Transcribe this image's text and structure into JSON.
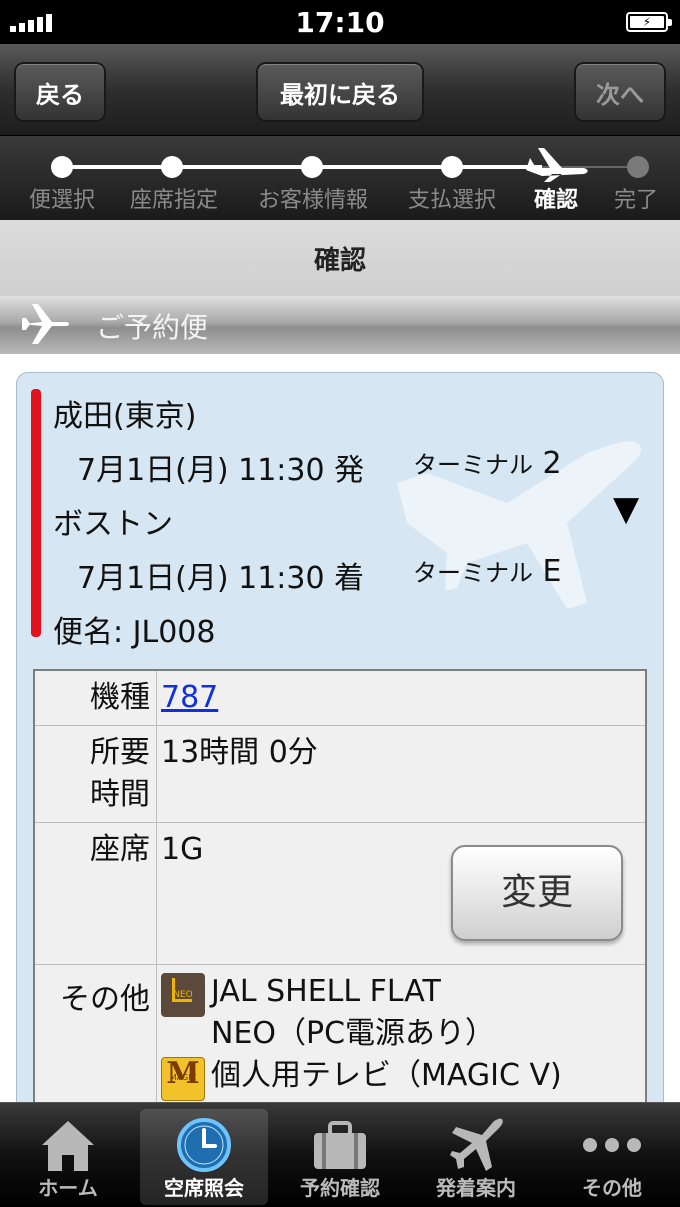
{
  "status": {
    "time": "17:10"
  },
  "nav": {
    "back": "戻る",
    "first": "最初に戻る",
    "next": "次へ"
  },
  "progress": {
    "steps": [
      "便選択",
      "座席指定",
      "お客様情報",
      "支払選択",
      "確認",
      "完了"
    ],
    "active_index": 4
  },
  "title": "確認",
  "section": {
    "label": "ご予約便"
  },
  "flight": {
    "origin": "成田(東京)",
    "depart": "7月1日(月) 11:30 発",
    "depart_terminal_label": "ターミナル",
    "depart_terminal": "2",
    "destination": "ボストン",
    "arrive": "7月1日(月) 11:30 着",
    "arrive_terminal_label": "ターミナル",
    "arrive_terminal": "E",
    "flight_no": "便名: JL008"
  },
  "details": {
    "aircraft_label": "機種",
    "aircraft": "787",
    "duration_label_1": "所要",
    "duration_label_2": "時間",
    "duration": "13時間 0分",
    "seat_label": "座席",
    "seat": "1G",
    "change_button": "変更",
    "other_label": "その他",
    "amenity1_line1": "JAL SHELL FLAT",
    "amenity1_line2": "NEO（PC電源あり）",
    "amenity1_icon": "NEO",
    "amenity2": "個人用テレビ（MAGIC V)",
    "amenity2_icon_letter": "M",
    "amenity2_icon_text": "MAGIC"
  },
  "tabs": [
    {
      "label": "ホーム",
      "icon": "home-icon"
    },
    {
      "label": "空席照会",
      "icon": "clock-icon"
    },
    {
      "label": "予約確認",
      "icon": "briefcase-icon"
    },
    {
      "label": "発着案内",
      "icon": "airplane-icon"
    },
    {
      "label": "その他",
      "icon": "more-icon"
    }
  ],
  "colors": {
    "accent_red": "#e0121b",
    "card_bg": "#d6e6f2",
    "link": "#1030e0"
  }
}
